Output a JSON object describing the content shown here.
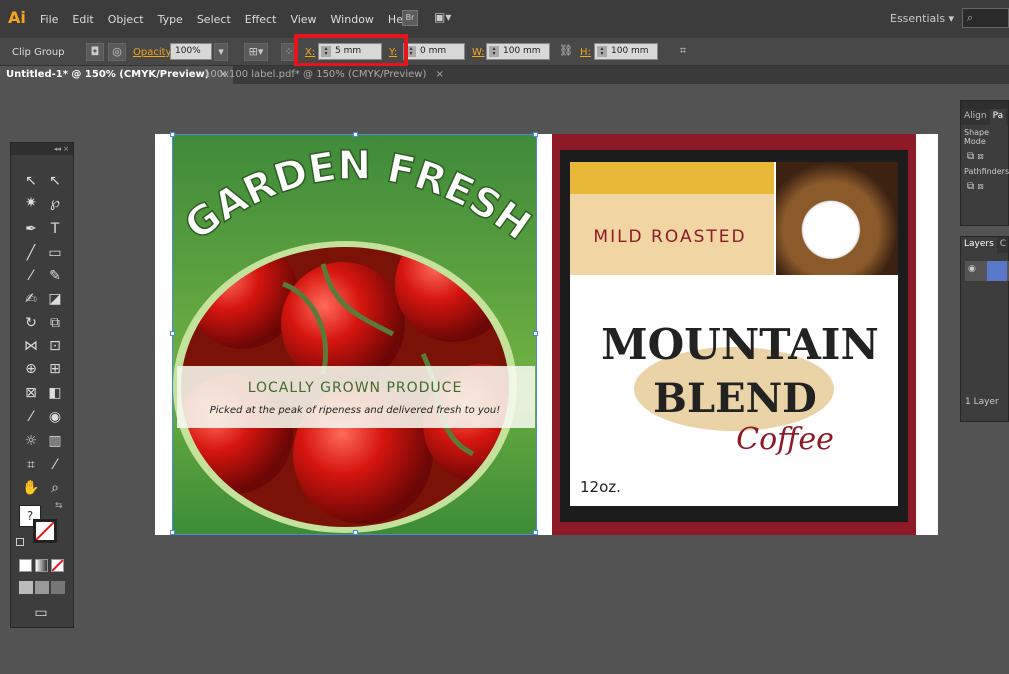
{
  "app": {
    "logo": "Ai",
    "menu": [
      "File",
      "Edit",
      "Object",
      "Type",
      "Select",
      "Effect",
      "View",
      "Window",
      "Help"
    ],
    "bridge_label": "Br",
    "workspace": "Essentials ▾",
    "search_placeholder": ""
  },
  "control_bar": {
    "selection": "Clip Group",
    "opacity_label": "Opacity:",
    "opacity_value": "100%",
    "x_label": "X:",
    "x_value": "5 mm",
    "y_label": "Y:",
    "y_value": "0 mm",
    "w_label": "W:",
    "w_value": "100 mm",
    "h_label": "H:",
    "h_value": "100 mm"
  },
  "tabs": [
    {
      "label": "Untitled-1* @ 150% (CMYK/Preview)",
      "close": "×"
    },
    {
      "label": "100x100 label.pdf* @ 150% (CMYK/Preview)",
      "close": "×"
    }
  ],
  "tools_header": "◂◂ ×",
  "artwork_left": {
    "title": "GARDEN FRESH",
    "band_title": "LOCALLY GROWN PRODUCE",
    "band_sub": "Picked at the peak of ripeness and delivered fresh to you!"
  },
  "artwork_right": {
    "top_text": "MILD ROASTED",
    "brand_line1": "MOUNTAIN",
    "brand_line2": "BLEND",
    "brand_line3": "Coffee",
    "size": "12oz."
  },
  "panels": {
    "align_tab": "Align",
    "pa_tab": "Pa",
    "shape_modes": "Shape Mode",
    "pathfinders": "Pathfinders",
    "layers_tab": "Layers",
    "layers_tab2": "C",
    "layer_count": "1 Layer"
  },
  "colors": {
    "highlight": "#e8141b",
    "green": "#5aa43c",
    "maroon": "#8e1a28"
  }
}
